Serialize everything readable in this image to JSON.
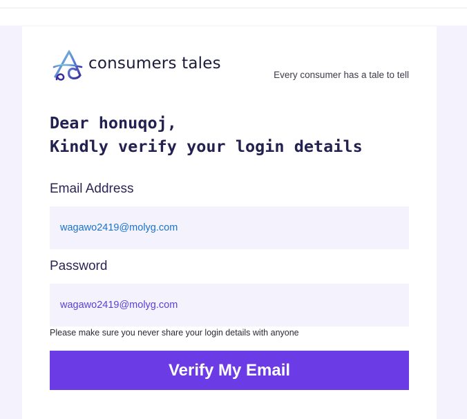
{
  "brand": {
    "logo_text": "consumers tales",
    "tagline": "Every consumer has a tale to tell"
  },
  "greeting": {
    "line1": "Dear honuqoj,",
    "line2": "Kindly verify your login details"
  },
  "form": {
    "email_label": "Email Address",
    "email_value": "wagawo2419@molyg.com",
    "password_label": "Password",
    "password_value": "wagawo2419@molyg.com",
    "note": "Please make sure you never share your login details with anyone",
    "submit_label": "Verify My Email"
  },
  "colors": {
    "accent": "#6b3ce6",
    "field_bg": "#f3f2fd",
    "heading": "#23214f",
    "email_text": "#1a73c9"
  },
  "icons": {
    "logo_mark": "consumers-tales-logo-icon"
  }
}
